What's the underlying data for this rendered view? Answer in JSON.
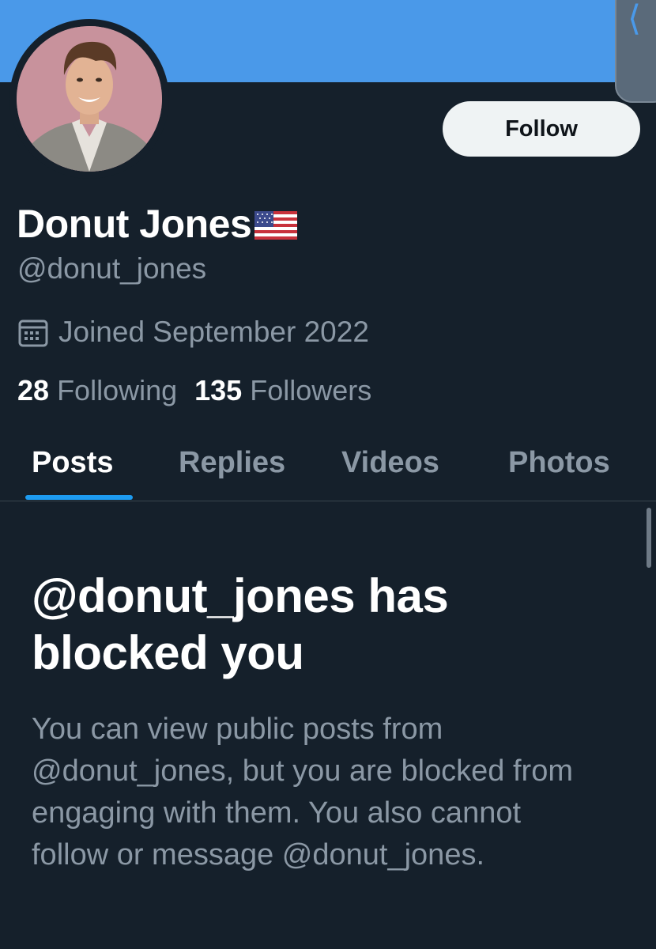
{
  "header": {
    "banner_color": "#4a99e9",
    "back_icon": "chevron-left-icon"
  },
  "profile": {
    "display_name": "Donut Jones",
    "name_emoji": "us-flag-icon",
    "handle": "@donut_jones",
    "joined": "Joined September 2022",
    "joined_icon": "calendar-icon",
    "following_count": "28",
    "following_label": "Following",
    "followers_count": "135",
    "followers_label": "Followers",
    "follow_button": "Follow"
  },
  "tabs": [
    {
      "label": "Posts",
      "active": true
    },
    {
      "label": "Replies",
      "active": false
    },
    {
      "label": "Videos",
      "active": false
    },
    {
      "label": "Photos",
      "active": false
    }
  ],
  "blocked": {
    "title": "@donut_jones has blocked you",
    "body": "You can view public posts from @donut_jones, but you are blocked from engaging with them. You also cannot follow or message @donut_jones."
  },
  "colors": {
    "background": "#15202b",
    "accent": "#1d9bf0",
    "secondary_text": "#8b98a5"
  }
}
